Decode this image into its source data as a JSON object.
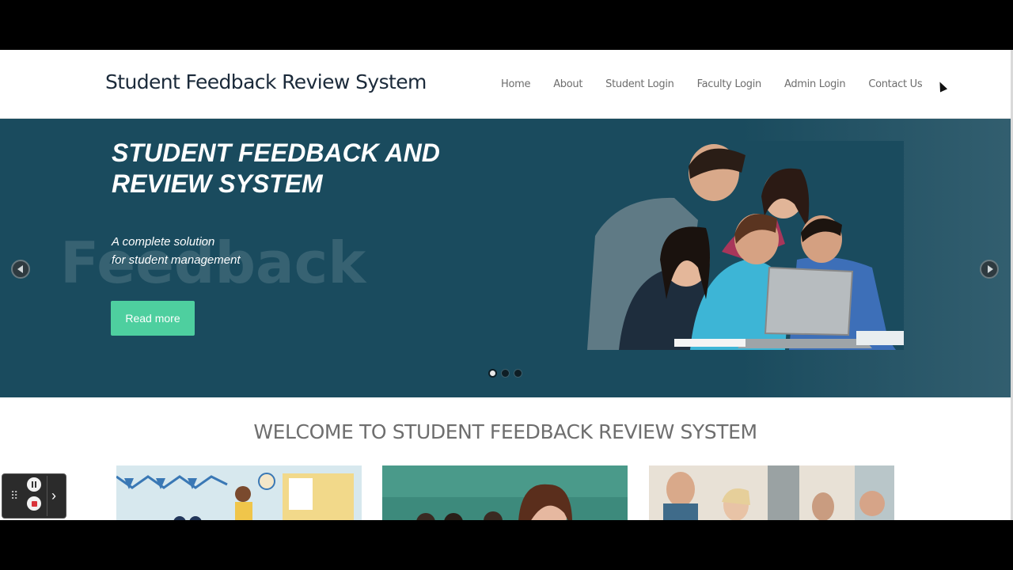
{
  "header": {
    "brand": "Student Feedback Review System",
    "nav": [
      "Home",
      "About",
      "Student Login",
      "Faculty Login",
      "Admin Login",
      "Contact Us"
    ]
  },
  "hero": {
    "title": "STUDENT FEEDBACK AND REVIEW SYSTEM",
    "subtitle": "A complete solution\nfor student management",
    "watermark": "Feedback",
    "button_label": "Read more",
    "slides_count": 3,
    "active_slide": 1
  },
  "welcome": {
    "heading": "WELCOME TO STUDENT FEEDBACK REVIEW SYSTEM"
  },
  "colors": {
    "hero_bg": "#1a4b5e",
    "accent_button": "#4ecf9f",
    "brand_text": "#1b2a3a"
  },
  "icons": [
    "prev-arrow-icon",
    "next-arrow-icon",
    "pause-icon",
    "stop-icon",
    "drag-grip-icon",
    "chevron-right-icon"
  ]
}
